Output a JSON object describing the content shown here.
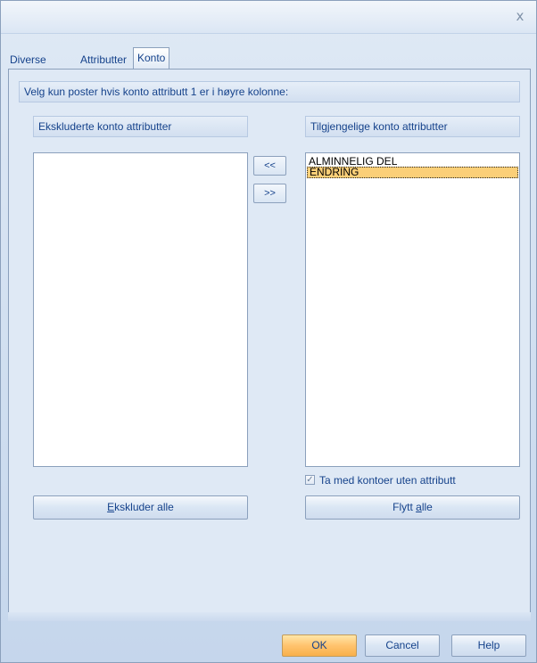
{
  "window": {
    "close_glyph": "x"
  },
  "tabs": [
    {
      "label": "Diverse",
      "active": false
    },
    {
      "label": "Attributter",
      "active": false
    },
    {
      "label": "Konto",
      "active": true
    }
  ],
  "konto": {
    "instruction": "Velg kun poster hvis konto attributt 1 er i høyre kolonne:",
    "excluded_header": "Ekskluderte konto attributter",
    "available_header": "Tilgjengelige konto attributter",
    "excluded_items": [],
    "available_items": [
      {
        "label": "ALMINNELIG DEL",
        "selected": false
      },
      {
        "label": "ENDRING",
        "selected": true
      }
    ],
    "move_left_label": "<<",
    "move_right_label": ">>",
    "include_no_attr": {
      "label": "Ta med kontoer uten attributt",
      "checked": true,
      "glyph": "✓"
    },
    "exclude_all_button": {
      "mnemonic": "E",
      "rest": "kskluder alle"
    },
    "move_all_button": {
      "before": "Flytt ",
      "mnemonic": "a",
      "after": "lle"
    }
  },
  "footer": {
    "ok_label": "OK",
    "cancel_label": "Cancel",
    "help_label": "Help"
  },
  "colors": {
    "accent_text": "#15428b",
    "selection": "#fbcf78",
    "ok_button": "#ffc36e"
  }
}
